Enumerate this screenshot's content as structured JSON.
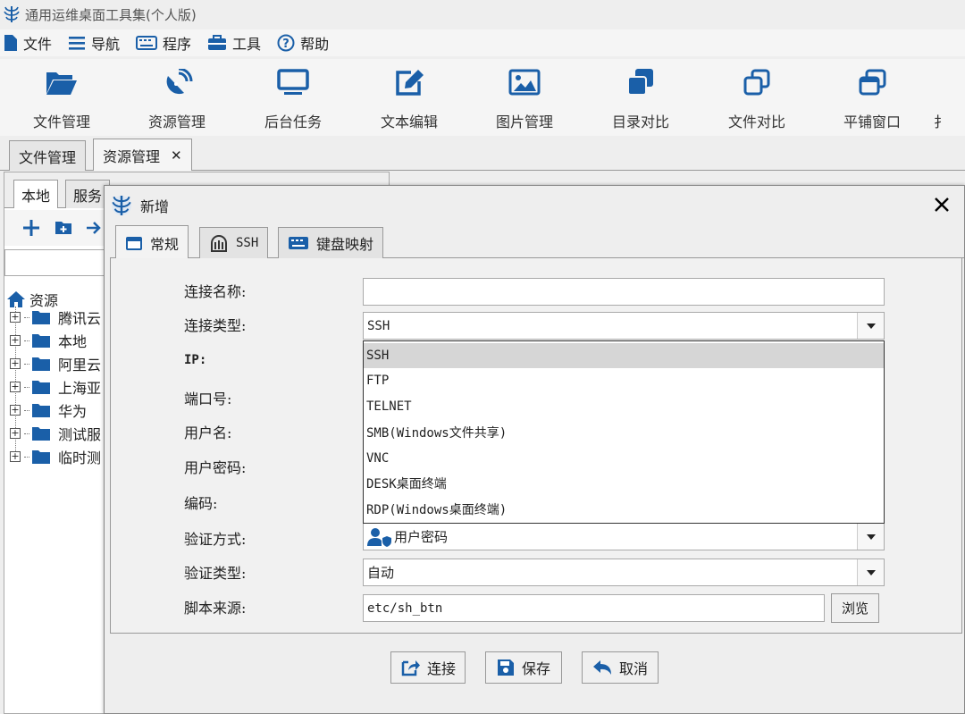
{
  "app": {
    "title": "通用运维桌面工具集(个人版)"
  },
  "menu": [
    {
      "label": "文件",
      "icon": "file-icon"
    },
    {
      "label": "导航",
      "icon": "menu-icon"
    },
    {
      "label": "程序",
      "icon": "keyboard-icon"
    },
    {
      "label": "工具",
      "icon": "toolbox-icon"
    },
    {
      "label": "帮助",
      "icon": "help-icon"
    }
  ],
  "toolbar": [
    {
      "label": "文件管理",
      "icon": "folder-open-icon"
    },
    {
      "label": "资源管理",
      "icon": "satellite-dish-icon"
    },
    {
      "label": "后台任务",
      "icon": "monitor-icon"
    },
    {
      "label": "文本编辑",
      "icon": "edit-icon"
    },
    {
      "label": "图片管理",
      "icon": "image-icon"
    },
    {
      "label": "目录对比",
      "icon": "clone-filled-icon"
    },
    {
      "label": "文件对比",
      "icon": "clone-outline-icon"
    },
    {
      "label": "平铺窗口",
      "icon": "window-restore-icon"
    },
    {
      "label": "扌",
      "icon": "tool-icon"
    }
  ],
  "main_tabs": [
    {
      "label": "文件管理"
    },
    {
      "label": "资源管理",
      "active": true
    }
  ],
  "left_panel": {
    "tabs": [
      "本地",
      "服务"
    ],
    "root": "资源",
    "tree": [
      "腾讯云",
      "本地",
      "阿里云",
      "上海亚",
      "华为",
      "测试服",
      "临时测"
    ]
  },
  "dialog": {
    "title": "新增",
    "tabs": [
      {
        "label": "常规",
        "icon": "window-icon"
      },
      {
        "label": "SSH",
        "icon": "terminal-icon"
      },
      {
        "label": "键盘映射",
        "icon": "keyboard-icon"
      }
    ],
    "fields": {
      "name_label": "连接名称:",
      "name_value": "",
      "type_label": "连接类型:",
      "type_value": "SSH",
      "ip_label": "IP:",
      "port_label": "端口号:",
      "user_label": "用户名:",
      "password_label": "用户密码:",
      "encoding_label": "编码:",
      "auth_method_label": "验证方式:",
      "auth_method_value": "用户密码",
      "auth_type_label": "验证类型:",
      "auth_type_value": "自动",
      "script_label": "脚本来源:",
      "script_value": "etc/sh_btn",
      "browse": "浏览"
    },
    "dropdown_options": [
      "SSH",
      "FTP",
      "TELNET",
      "SMB(Windows文件共享)",
      "VNC",
      "DESK桌面终端",
      "RDP(Windows桌面终端)"
    ],
    "buttons": {
      "connect": "连接",
      "save": "保存",
      "cancel": "取消"
    }
  },
  "colors": {
    "icon_blue": "#1a5fa8",
    "highlight": "#d6d6d6"
  }
}
